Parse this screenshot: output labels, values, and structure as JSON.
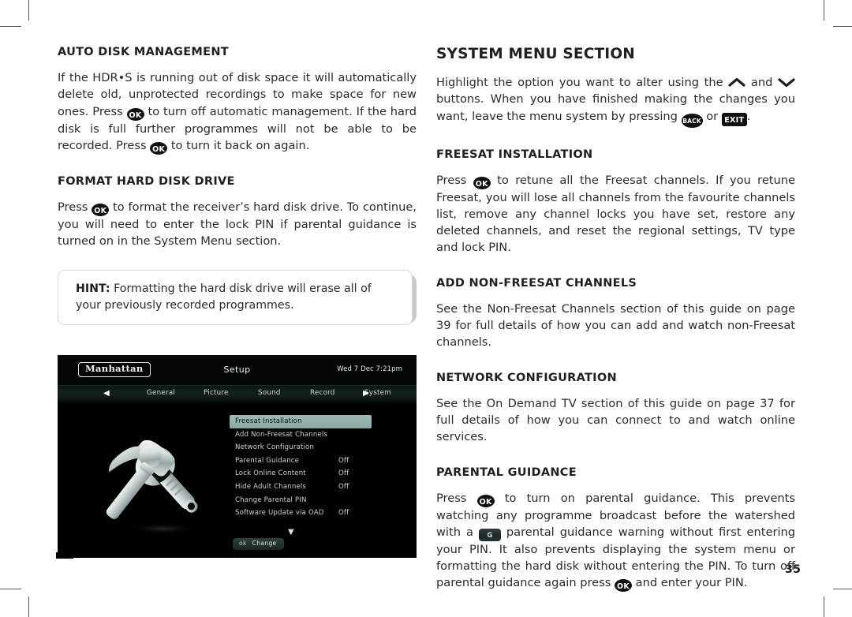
{
  "page": {
    "number": "35"
  },
  "left_column": {
    "section1": {
      "heading": "AUTO DISK MANAGEMENT",
      "para_part1": "If the HDR•S is running out of disk space it will automatically delete old, unprotected recordings to make space for new ones. Press",
      "key1": "OK",
      "para_part2": "to turn off automatic management. If the hard disk is full further programmes will not be able to be recorded. Press",
      "key2": "OK",
      "para_part3": "to turn it back on again."
    },
    "section2": {
      "heading": "FORMAT HARD DISK DRIVE",
      "para_part1": "Press",
      "key1": "OK",
      "para_part2": "to format the receiver’s hard disk drive. To continue, you will need to enter the lock PIN if parental guidance is turned on in the System Menu section."
    },
    "hint": {
      "label": "HINT:",
      "text": "Formatting the hard disk drive will erase all of your previously recorded programmes."
    }
  },
  "tv_screenshot": {
    "logo": "Manhattan",
    "title": "Setup",
    "clock": "Wed 7 Dec 7:21pm",
    "tabs": [
      {
        "label": "General"
      },
      {
        "label": "Picture"
      },
      {
        "label": "Sound"
      },
      {
        "label": "Record"
      },
      {
        "label": "System"
      }
    ],
    "left_arrow": "◀",
    "right_arrow": "▶",
    "menu_items": [
      {
        "label": "Freesat Installation",
        "value": "",
        "selected": true
      },
      {
        "label": "Add Non-Freesat Channels",
        "value": "",
        "selected": false
      },
      {
        "label": "Network Configuration",
        "value": "",
        "selected": false
      },
      {
        "label": "Parental Guidance",
        "value": "Off",
        "selected": false
      },
      {
        "label": "Lock Online Content",
        "value": "Off",
        "selected": false
      },
      {
        "label": "Hide Adult Channels",
        "value": "Off",
        "selected": false
      },
      {
        "label": "Change Parental PIN",
        "value": "",
        "selected": false
      },
      {
        "label": "Software Update via OAD",
        "value": "Off",
        "selected": false
      }
    ],
    "scroll_down_arrow": "▼",
    "action_button": {
      "key": "ok",
      "label": "Change"
    },
    "illustration": "hammer-and-wrench-tools"
  },
  "right_column": {
    "main_heading": "SYSTEM MENU SECTION",
    "intro": {
      "para_part1": "Highlight the option you want to alter using the",
      "chevron_up": "chevron-up",
      "para_part2": "and",
      "chevron_down": "chevron-down",
      "para_part3": "buttons. When you have finished making the changes you want, leave the menu system by pressing",
      "key_back": "BACK",
      "para_part4": "or",
      "key_exit": "EXIT",
      "para_part5": "."
    },
    "section_freesat": {
      "heading": "FREESAT INSTALLATION",
      "para_part1": "Press",
      "key1": "OK",
      "para_part2": "to retune all the Freesat channels. If you retune Freesat, you will lose all channels from the favourite channels list, remove any channel locks you have set, restore any deleted channels, and reset the regional settings, TV type and lock PIN."
    },
    "section_nonfreesat": {
      "heading": "ADD NON-FREESAT CHANNELS",
      "para": "See the Non-Freesat Channels section of this guide on page 39 for full details of how you can add and watch non-Freesat channels."
    },
    "section_network": {
      "heading": "NETWORK CONFIGURATION",
      "para": "See the On Demand TV section of this guide on page 37 for full details of how you can connect to and watch online services."
    },
    "section_parental": {
      "heading": "PARENTAL GUIDANCE",
      "para_part1": "Press",
      "key1": "OK",
      "para_part2": "to turn on parental guidance. This prevents watching any programme broadcast before the watershed with a",
      "badge_g": "G",
      "para_part3": "parental guidance warning without first entering your PIN. It also prevents displaying the system menu or formatting the hard disk without entering the PIN. To turn off parental guidance again press",
      "key2": "OK",
      "para_part4": "and enter your PIN."
    }
  },
  "colors": {
    "text": "#231f20",
    "key_badge": "#111111",
    "tv_background": "#000000",
    "tv_highlight": "#9fb9b6",
    "hint_border": "#d8d9da"
  }
}
